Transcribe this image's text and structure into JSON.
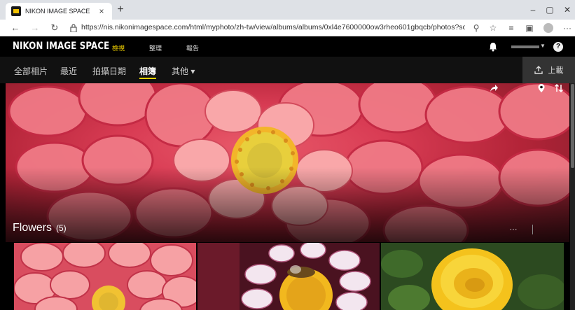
{
  "browser": {
    "tab_title": "NIKON IMAGE SPACE",
    "tab_close": "×",
    "new_tab": "+",
    "url": "https://nis.nikonimagespace.com/html/mypho​to/zh-tw/view/albums/albums/0xl4e7600000ow3rheo601gbqcb/photos?sortBy=...",
    "min": "–",
    "max": "▢",
    "close": "✕",
    "back": "←",
    "forward": "→",
    "reload": "↻",
    "more": "···"
  },
  "header": {
    "brand": "NIKON IMAGE SPACE",
    "nav": [
      {
        "label": "檢視",
        "active": true
      },
      {
        "label": "整理",
        "active": false
      },
      {
        "label": "報告",
        "active": false
      }
    ],
    "help": "?"
  },
  "subnav": {
    "items": [
      {
        "label": "全部相片"
      },
      {
        "label": "最近"
      },
      {
        "label": "拍攝日期"
      },
      {
        "label": "相簿",
        "active": true
      },
      {
        "label": "其他 ▾"
      }
    ],
    "upload_label": "上載"
  },
  "album": {
    "title": "Flowers",
    "count": "(5)"
  },
  "icons": {
    "share": "share-icon",
    "more": "more-icon",
    "location": "location-icon",
    "sort": "sort-icon",
    "upload": "upload-icon",
    "bell": "bell-icon"
  },
  "colors": {
    "accent": "#f5d400",
    "header_bg": "#000000",
    "subnav_bg": "#111111"
  }
}
